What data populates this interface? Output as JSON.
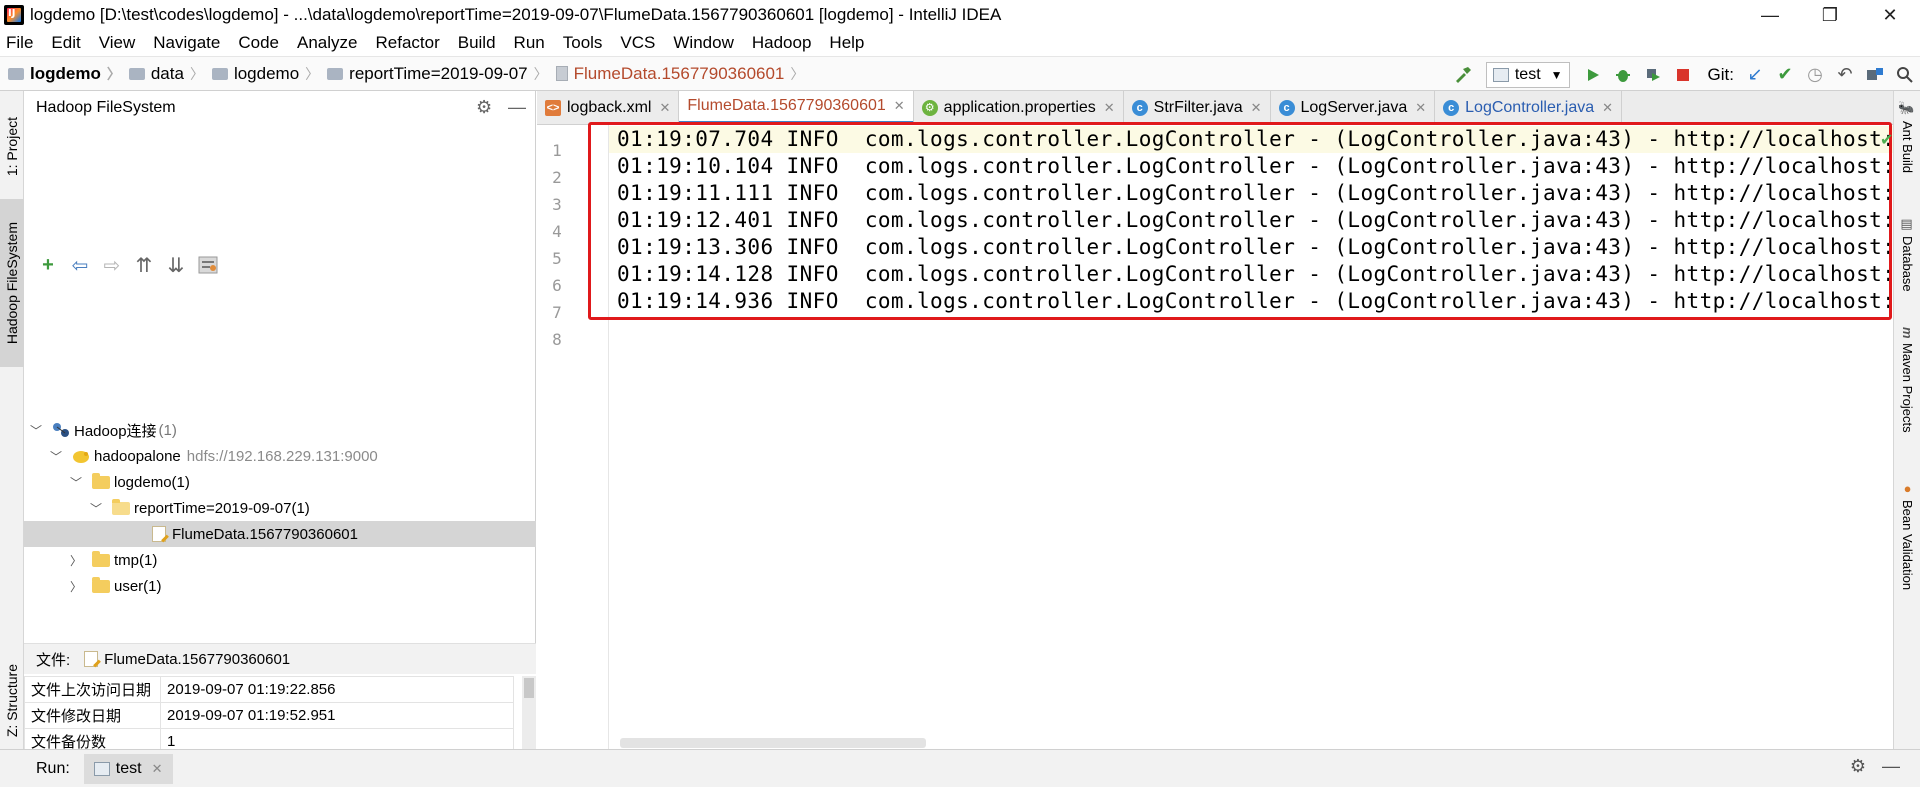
{
  "window": {
    "title": "logdemo [D:\\test\\codes\\logdemo] - ...\\data\\logdemo\\reportTime=2019-09-07\\FlumeData.1567790360601 [logdemo] - IntelliJ IDEA",
    "minimize": "—",
    "restore": "❐",
    "close": "✕"
  },
  "menu": [
    "File",
    "Edit",
    "View",
    "Navigate",
    "Code",
    "Analyze",
    "Refactor",
    "Build",
    "Run",
    "Tools",
    "VCS",
    "Window",
    "Hadoop",
    "Help"
  ],
  "breadcrumb": {
    "project": "logdemo",
    "folder1": "data",
    "folder2": "logdemo",
    "folder3": "reportTime=2019-09-07",
    "file": "FlumeData.1567790360601"
  },
  "toolbar": {
    "run_config": "test",
    "git_label": "Git:"
  },
  "left_strip": {
    "project_tab": "1: Project",
    "hadoop_tab": "Hadoop FileSystem",
    "structure_tab": "Z: Structure"
  },
  "hadoop_panel": {
    "title": "Hadoop FileSystem",
    "tree": {
      "root_label": "Hadoop连接",
      "root_count": "(1)",
      "server_label": "hadoopalone",
      "server_url": "hdfs://192.168.229.131:9000",
      "logdemo": "logdemo(1)",
      "report": "reportTime=2019-09-07(1)",
      "file": "FlumeData.1567790360601",
      "tmp": "tmp(1)",
      "user": "user(1)"
    },
    "file_info": {
      "file_label": "文件:",
      "file_name": "FlumeData.1567790360601",
      "rows": [
        {
          "key": "文件上次访问日期",
          "value": "2019-09-07 01:19:22.856"
        },
        {
          "key": "文件修改日期",
          "value": "2019-09-07 01:19:52.951"
        },
        {
          "key": "文件备份数",
          "value": "1"
        }
      ]
    }
  },
  "tabs": [
    {
      "label": "logback.xml"
    },
    {
      "label": "FlumeData.1567790360601"
    },
    {
      "label": "application.properties"
    },
    {
      "label": "StrFilter.java"
    },
    {
      "label": "LogServer.java"
    },
    {
      "label": "LogController.java"
    }
  ],
  "editor": {
    "line_numbers": [
      "1",
      "2",
      "3",
      "4",
      "5",
      "6",
      "7",
      "8"
    ],
    "lines": [
      "01:19:07.704 INFO  com.logs.controller.LogController - (LogController.java:43) - http://localhost:",
      "01:19:10.104 INFO  com.logs.controller.LogController - (LogController.java:43) - http://localhost:",
      "01:19:11.111 INFO  com.logs.controller.LogController - (LogController.java:43) - http://localhost:",
      "01:19:12.401 INFO  com.logs.controller.LogController - (LogController.java:43) - http://localhost:",
      "01:19:13.306 INFO  com.logs.controller.LogController - (LogController.java:43) - http://localhost:",
      "01:19:14.128 INFO  com.logs.controller.LogController - (LogController.java:43) - http://localhost:",
      "01:19:14.936 INFO  com.logs.controller.LogController - (LogController.java:43) - http://localhost:"
    ]
  },
  "right_strip": {
    "ant": "Ant Build",
    "database": "Database",
    "maven": "Maven Projects",
    "bean": "Bean Validation"
  },
  "run_bar": {
    "label": "Run:",
    "tab": "test"
  },
  "colors": {
    "highlight_box": "#e0191b",
    "active_tab_text": "#b44a2c",
    "current_line": "#fcfae4"
  }
}
